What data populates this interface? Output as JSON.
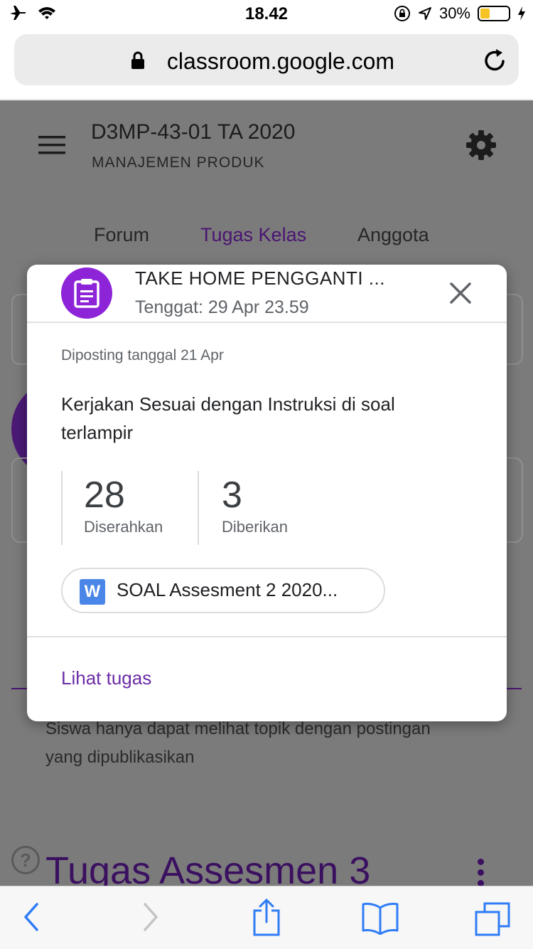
{
  "status_bar": {
    "time": "18.42",
    "battery": "30%",
    "battery_level": 0.3
  },
  "browser": {
    "url": "classroom.google.com"
  },
  "class_header": {
    "title": "D3MP-43-01 TA 2020",
    "subtitle": "MANAJEMEN PRODUK"
  },
  "tabs": [
    {
      "label": "Forum"
    },
    {
      "label": "Tugas Kelas"
    },
    {
      "label": "Anggota"
    }
  ],
  "background": {
    "note": "Siswa hanya dapat melihat topik dengan postingan yang dipublikasikan",
    "topic_title": "Tugas Assesmen 3"
  },
  "modal": {
    "title": "TAKE HOME PENGGANTI ...",
    "due": "Tenggat: 29 Apr 23.59",
    "posted": "Diposting tanggal 21 Apr",
    "description": "Kerjakan Sesuai dengan Instruksi di soal terlampir",
    "stats": [
      {
        "value": "28",
        "label": "Diserahkan"
      },
      {
        "value": "3",
        "label": "Diberikan"
      }
    ],
    "attachment": {
      "badge": "W",
      "name": "SOAL Assesment 2 2020..."
    },
    "link": "Lihat tugas"
  },
  "colors": {
    "accent": "#6b2ca6",
    "assignment_icon": "#8e24d8",
    "word_blue": "#4a86e8",
    "ios_blue": "#2f7cf6"
  }
}
